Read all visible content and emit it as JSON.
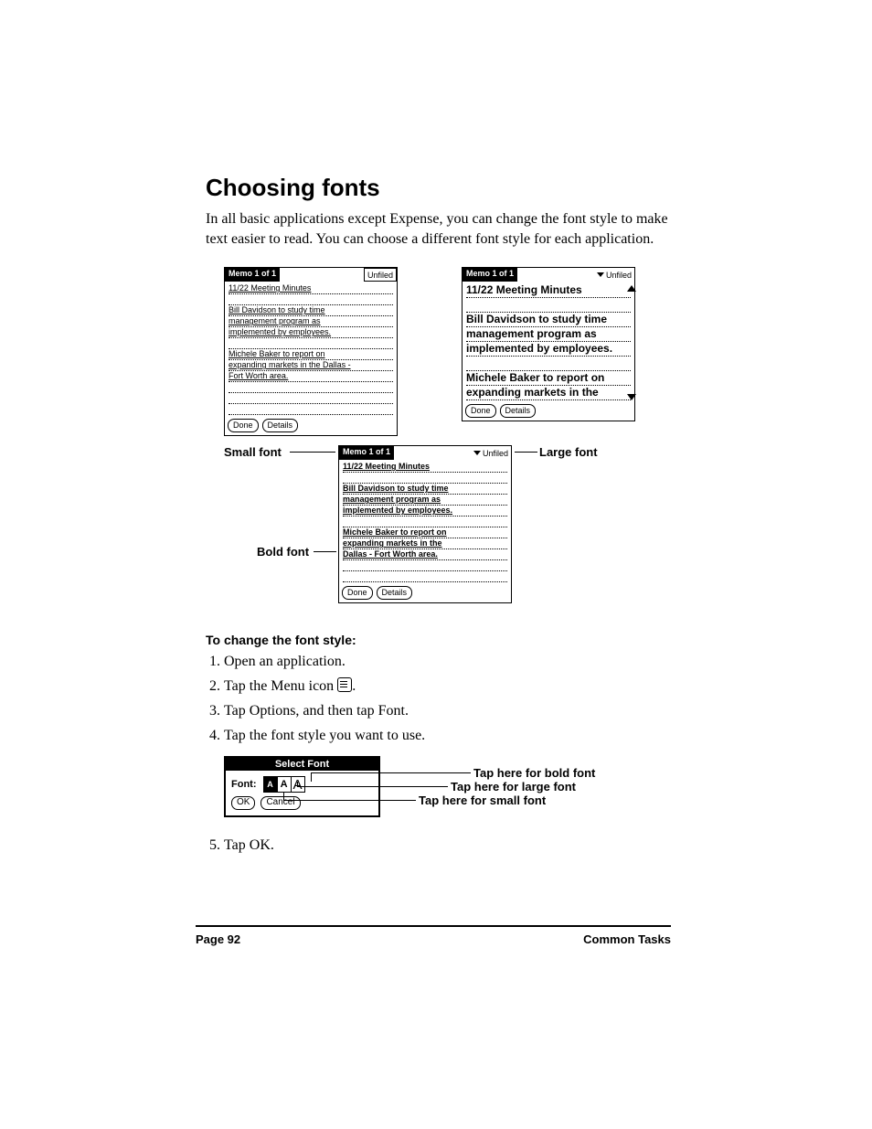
{
  "title": "Choosing fonts",
  "intro": "In all basic applications except Expense, you can change the font style to make text easier to read. You can choose a different font style for each application.",
  "memo": {
    "header_title": "Memo 1 of 1",
    "category": "Unfiled",
    "title": "11/22 Meeting Minutes",
    "p1_l1": "Bill Davidson to study time",
    "p1_l2": "management program as",
    "p1_l3": "implemented by employees.",
    "p2_l1": "Michele Baker to report on",
    "p2_l2": "expanding markets in the Dallas -",
    "p2_l3": "Fort Worth area.",
    "p2_l2_short": "expanding markets in the",
    "p2_l3_short": "Dallas - Fort Worth area.",
    "btn_done": "Done",
    "btn_details": "Details"
  },
  "labels": {
    "small_font": "Small font",
    "large_font": "Large font",
    "bold_font": "Bold font"
  },
  "instruction_header": "To change the font style:",
  "steps": {
    "s1": "Open an application.",
    "s2a": "Tap the Menu icon ",
    "s2b": ".",
    "s3": "Tap Options, and then tap Font.",
    "s4": "Tap the font style you want to use.",
    "s5": "Tap OK."
  },
  "dialog": {
    "title": "Select Font",
    "label": "Font:",
    "opt_small": "A",
    "opt_large": "A",
    "opt_bold": "A",
    "ok": "OK",
    "cancel": "Cancel",
    "c_bold": "Tap here for bold font",
    "c_large": "Tap here for large font",
    "c_small": "Tap here for small font"
  },
  "footer": {
    "page": "Page 92",
    "section": "Common Tasks"
  }
}
